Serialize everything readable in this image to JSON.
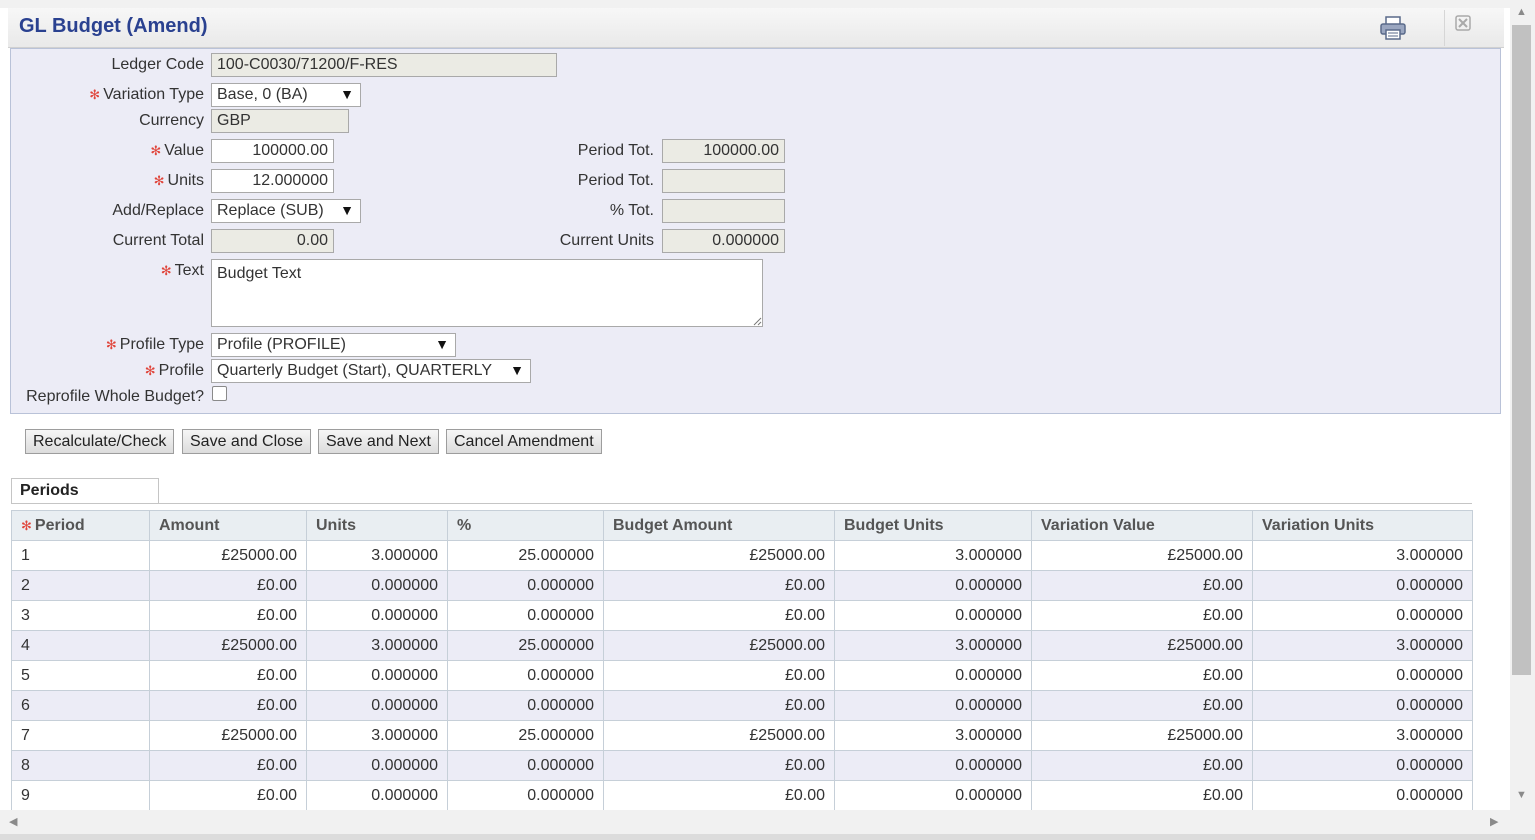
{
  "dialog": {
    "title": "GL Budget (Amend)",
    "print_icon": "printer-icon",
    "close_icon": "close-icon"
  },
  "form": {
    "ledger_code": {
      "label": "Ledger Code",
      "value": "100-C0030/71200/F-RES"
    },
    "variation_type": {
      "label": "Variation Type",
      "value": "Base, 0 (BA)",
      "required": true
    },
    "currency": {
      "label": "Currency",
      "value": "GBP"
    },
    "value": {
      "label": "Value",
      "value": "100000.00",
      "required": true
    },
    "units": {
      "label": "Units",
      "value": "12.000000",
      "required": true
    },
    "add_replace": {
      "label": "Add/Replace",
      "value": "Replace (SUB)"
    },
    "current_total": {
      "label": "Current Total",
      "value": "0.00"
    },
    "text": {
      "label": "Text",
      "value": "Budget Text",
      "required": true
    },
    "profile_type": {
      "label": "Profile Type",
      "value": "Profile (PROFILE)",
      "required": true
    },
    "profile": {
      "label": "Profile",
      "value": "Quarterly Budget (Start), QUARTERLY",
      "required": true
    },
    "reprofile": {
      "label": "Reprofile Whole Budget?",
      "checked": false
    },
    "period_tot_value": {
      "label": "Period Tot.",
      "value": "100000.00"
    },
    "period_tot_units": {
      "label": "Period Tot.",
      "value": ""
    },
    "pct_tot": {
      "label": "% Tot.",
      "value": ""
    },
    "current_units": {
      "label": "Current Units",
      "value": "0.000000"
    }
  },
  "buttons": {
    "recalculate": "Recalculate/Check",
    "save_close": "Save and Close",
    "save_next": "Save and Next",
    "cancel": "Cancel Amendment"
  },
  "tabs": {
    "periods": "Periods"
  },
  "table": {
    "columns": [
      "Period",
      "Amount",
      "Units",
      "%",
      "Budget Amount",
      "Budget Units",
      "Variation Value",
      "Variation Units"
    ],
    "rows": [
      [
        "1",
        "£25000.00",
        "3.000000",
        "25.000000",
        "£25000.00",
        "3.000000",
        "£25000.00",
        "3.000000"
      ],
      [
        "2",
        "£0.00",
        "0.000000",
        "0.000000",
        "£0.00",
        "0.000000",
        "£0.00",
        "0.000000"
      ],
      [
        "3",
        "£0.00",
        "0.000000",
        "0.000000",
        "£0.00",
        "0.000000",
        "£0.00",
        "0.000000"
      ],
      [
        "4",
        "£25000.00",
        "3.000000",
        "25.000000",
        "£25000.00",
        "3.000000",
        "£25000.00",
        "3.000000"
      ],
      [
        "5",
        "£0.00",
        "0.000000",
        "0.000000",
        "£0.00",
        "0.000000",
        "£0.00",
        "0.000000"
      ],
      [
        "6",
        "£0.00",
        "0.000000",
        "0.000000",
        "£0.00",
        "0.000000",
        "£0.00",
        "0.000000"
      ],
      [
        "7",
        "£25000.00",
        "3.000000",
        "25.000000",
        "£25000.00",
        "3.000000",
        "£25000.00",
        "3.000000"
      ],
      [
        "8",
        "£0.00",
        "0.000000",
        "0.000000",
        "£0.00",
        "0.000000",
        "£0.00",
        "0.000000"
      ],
      [
        "9",
        "£0.00",
        "0.000000",
        "0.000000",
        "£0.00",
        "0.000000",
        "£0.00",
        "0.000000"
      ]
    ]
  },
  "colors": {
    "title": "#2a4190",
    "required": "#e0453b",
    "panel_bg": "#ececf6",
    "readonly_bg": "#ebebe4"
  }
}
